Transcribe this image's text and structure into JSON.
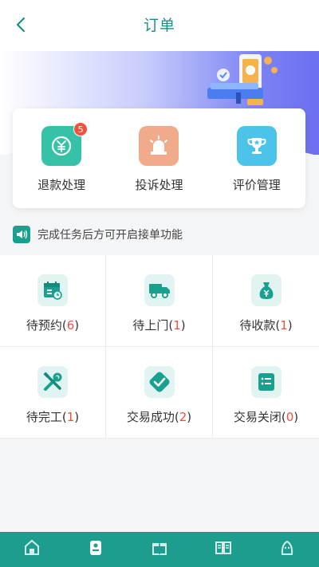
{
  "header": {
    "title": "订单"
  },
  "actions": [
    {
      "label": "退款处理",
      "badge": "5",
      "color": "#36c2a6"
    },
    {
      "label": "投诉处理",
      "color": "#f2ab8a"
    },
    {
      "label": "评价管理",
      "color": "#4cc3e8"
    }
  ],
  "notice": {
    "text": "完成任务后方可开启接单功能"
  },
  "grid": [
    {
      "name": "待预约",
      "count": "6",
      "icon": "calendar-icon"
    },
    {
      "name": "待上门",
      "count": "1",
      "icon": "truck-icon"
    },
    {
      "name": "待收款",
      "count": "1",
      "icon": "money-bag-icon"
    },
    {
      "name": "待完工",
      "count": "1",
      "icon": "tools-icon"
    },
    {
      "name": "交易成功",
      "count": "2",
      "icon": "check-icon"
    },
    {
      "name": "交易关闭",
      "count": "0",
      "icon": "list-icon"
    }
  ],
  "tabbar": {
    "background": "#1c9d8e"
  }
}
